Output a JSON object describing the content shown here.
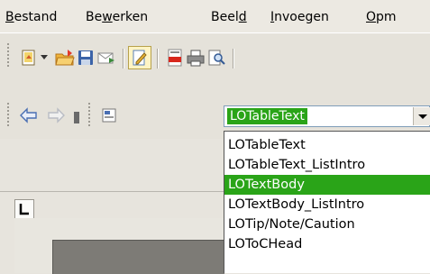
{
  "menubar": {
    "items": [
      {
        "pre": "",
        "mn": "B",
        "post": "estand"
      },
      {
        "pre": "Be",
        "mn": "w",
        "post": "erken"
      },
      {
        "pre": "Beel",
        "mn": "d",
        "post": ""
      },
      {
        "pre": "",
        "mn": "I",
        "post": "nvoegen"
      },
      {
        "pre": "",
        "mn": "O",
        "post": "pm"
      }
    ]
  },
  "toolbar_standard": {
    "buttons": [
      "new-document-icon",
      "dropdown-arrow-icon",
      "open-folder-icon",
      "save-icon",
      "email-icon",
      "edit-mode-icon",
      "export-pdf-icon",
      "print-icon",
      "print-preview-icon"
    ]
  },
  "toolbar_formatting": {
    "buttons": [
      "back-arrow-icon",
      "forward-arrow-icon",
      "toolbar-overflow-icon",
      "styles-formatting-icon"
    ],
    "style_combo": {
      "value": "LOTableText"
    }
  },
  "style_list": {
    "options": [
      "LOTableText",
      "LOTableText_ListIntro",
      "LOTextBody",
      "LOTextBody_ListIntro",
      "LOTip/Note/Caution",
      "LOToCHead"
    ],
    "selected": "LOTextBody"
  },
  "colors": {
    "selection": "#2aa418",
    "background": "#e7e4dd"
  }
}
